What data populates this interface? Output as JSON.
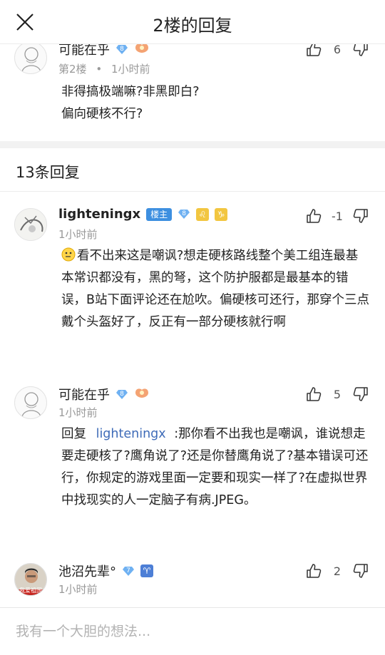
{
  "header": {
    "title": "2楼的回复",
    "close_icon": "close-icon"
  },
  "main_post": {
    "username": "可能在乎",
    "level": "8",
    "floor": "第2楼",
    "separator": "•",
    "time": "1小时前",
    "likes": "6",
    "content_lines": [
      "非得搞极端嘛?非黑即白?",
      "偏向硬核不行?"
    ]
  },
  "replies_header": "13条回复",
  "comments": [
    {
      "username": "lighteningx",
      "host_badge": "楼主",
      "level": "8",
      "zodiac": [
        "♌",
        "♑"
      ],
      "time": "1小时前",
      "likes": "-1",
      "content": "看不出来这是嘲讽?想走硬核路线整个美工组连最基本常识都没有，黑的弩，这个防护服都是最基本的错误，B站下面评论还在尬吹。偏硬核可还行，那穿个三点戴个头盔好了，反正有一部分硬核就行啊"
    },
    {
      "username": "可能在乎",
      "level": "8",
      "time": "1小时前",
      "likes": "5",
      "reply_prefix": "回复",
      "mention": "lighteningx",
      "content": ":那你看不出我也是嘲讽，谁说想走要走硬核了?鹰角说了?还是你替鹰角说了?基本错误可还行，你规定的游戏里面一定要和现实一样了?在虚拟世界中找现实的人一定脑子有病.JPEG。"
    },
    {
      "username": "池沼先辈°",
      "level": "7",
      "zodiac": [
        "♈"
      ],
      "time": "1小时前",
      "likes": "2",
      "avatar_caption": "我爱祖国"
    }
  ],
  "input": {
    "placeholder": "我有一个大胆的想法..."
  },
  "colors": {
    "accent": "#3d8fe0",
    "mention": "#3e6bb8",
    "muted": "#999999"
  }
}
